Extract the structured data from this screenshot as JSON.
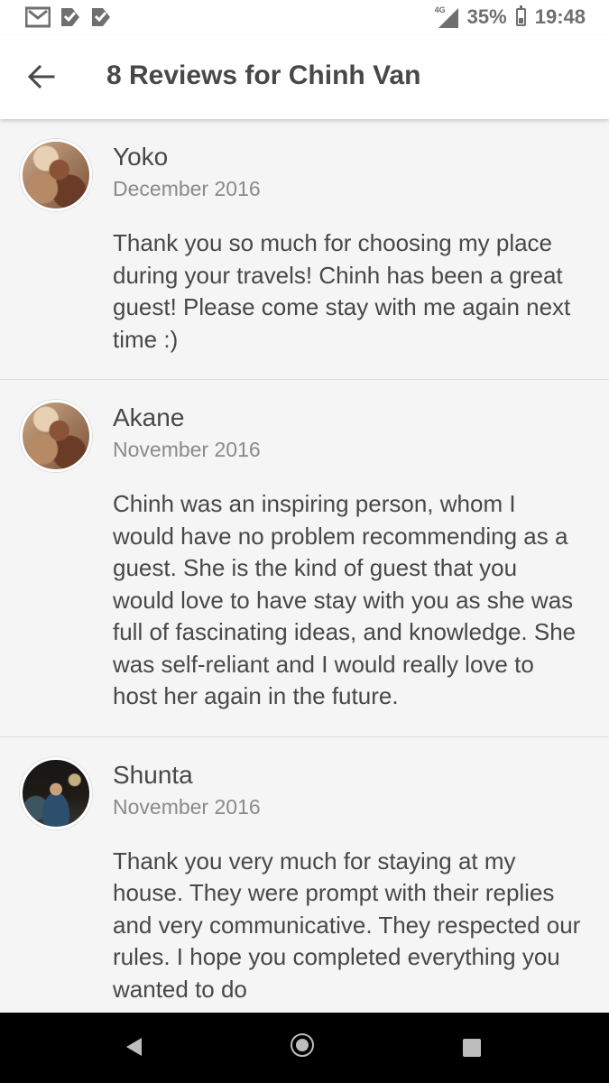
{
  "status_bar": {
    "network": "4G",
    "battery_percent": "35%",
    "battery_level": 0.35,
    "time": "19:48",
    "notification_icons": [
      "gmail-icon",
      "check-icon",
      "check-icon"
    ]
  },
  "header": {
    "back_icon": "arrow-left-icon",
    "title": "8 Reviews for Chinh Van"
  },
  "reviews": [
    {
      "name": "Yoko",
      "date": "December 2016",
      "text": "Thank you so much for choosing my place during your travels! Chinh has been a great guest! Please come stay with me again next time :)"
    },
    {
      "name": "Akane",
      "date": "November 2016",
      "text": "Chinh was an inspiring person, whom I would have no problem recommending as a guest. She is the kind of guest that you would love to have stay with you as she was full of fascinating ideas, and knowledge. She was self-reliant and I would really love to host her again in the future."
    },
    {
      "name": "Shunta",
      "date": "November 2016",
      "text": "Thank you very much for staying at my house. They were prompt with their replies and very communicative. They respected our rules. I hope you completed everything you wanted to do"
    }
  ],
  "nav_bar": {
    "icons": [
      "nav-back-icon",
      "nav-home-icon",
      "nav-recents-icon"
    ]
  }
}
